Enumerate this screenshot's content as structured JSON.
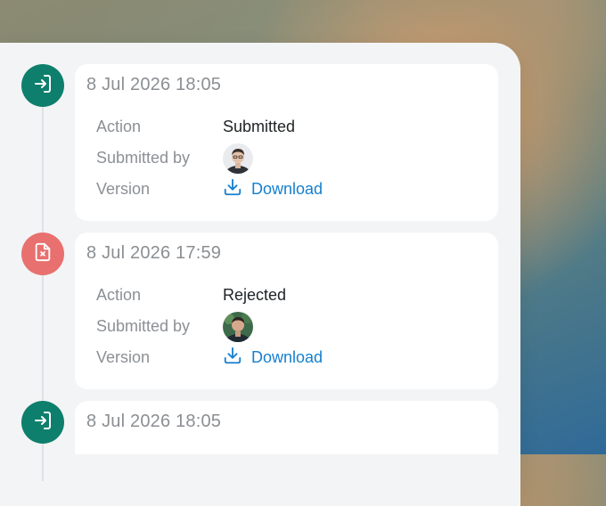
{
  "timeline": {
    "entries": [
      {
        "status": "submitted",
        "date": "8 Jul 2026 18:05",
        "action_label": "Action",
        "action_value": "Submitted",
        "submitted_by_label": "Submitted by",
        "version_label": "Version",
        "version_link": "Download"
      },
      {
        "status": "rejected",
        "date": "8 Jul 2026 17:59",
        "action_label": "Action",
        "action_value": "Rejected",
        "submitted_by_label": "Submitted by",
        "version_label": "Version",
        "version_link": "Download"
      },
      {
        "status": "submitted",
        "date": "8 Jul 2026 18:05"
      }
    ]
  },
  "icons": {
    "submitted": "login-arrow-icon",
    "rejected": "file-x-icon",
    "download": "download-icon",
    "avatar": "user-avatar"
  },
  "colors": {
    "submitted_node": "#0e7f6c",
    "rejected_node": "#e8706f",
    "link": "#1680cf",
    "label": "#8c9095",
    "date": "#8b8f93"
  }
}
